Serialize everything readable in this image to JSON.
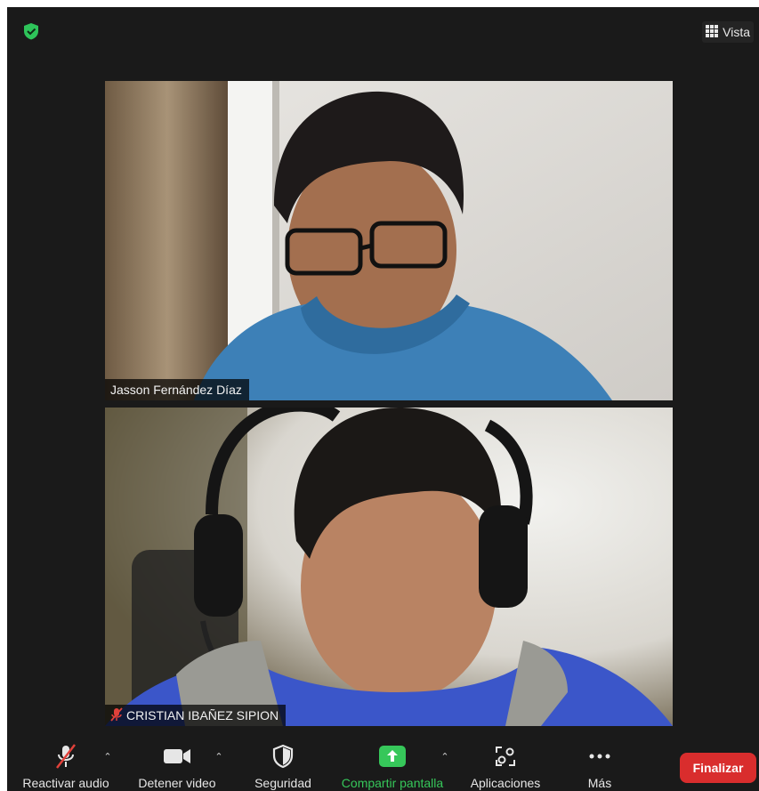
{
  "header": {
    "view_label": "Vista"
  },
  "participants": [
    {
      "name": "Jasson Fernández Díaz",
      "muted": false
    },
    {
      "name": "CRISTIAN IBAÑEZ SIPION",
      "muted": true
    }
  ],
  "toolbar": {
    "audio_label": "Reactivar audio",
    "video_label": "Detener video",
    "security_label": "Seguridad",
    "share_label": "Compartir pantalla",
    "apps_label": "Aplicaciones",
    "more_label": "Más",
    "end_label": "Finalizar"
  },
  "colors": {
    "background": "#1a1a1a",
    "share_green": "#36c75a",
    "end_red": "#d92d2d",
    "muted_red": "#e0413a"
  }
}
